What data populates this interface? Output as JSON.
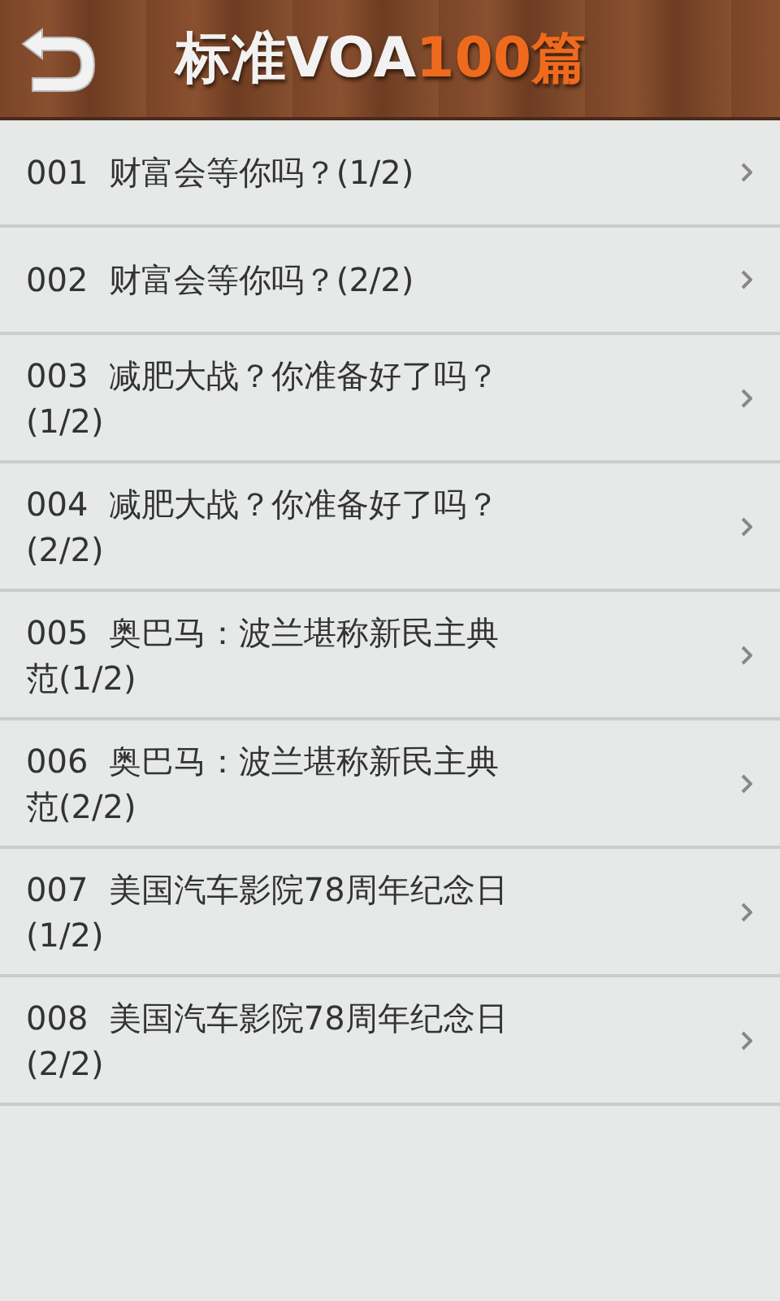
{
  "header": {
    "title": "标准VOA",
    "title_accent": "100篇"
  },
  "items": [
    {
      "number": "001",
      "title": "财富会等你吗？(1/2)"
    },
    {
      "number": "002",
      "title": "财富会等你吗？(2/2)"
    },
    {
      "number": "003",
      "title": "减肥大战？你准备好了吗？(1/2)"
    },
    {
      "number": "004",
      "title": "减肥大战？你准备好了吗？(2/2)"
    },
    {
      "number": "005",
      "title": "奥巴马：波兰堪称新民主典范(1/2)"
    },
    {
      "number": "006",
      "title": "奥巴马：波兰堪称新民主典范(2/2)"
    },
    {
      "number": "007",
      "title": "美国汽车影院78周年纪念日(1/2)"
    },
    {
      "number": "008",
      "title": "美国汽车影院78周年纪念日(2/2)"
    }
  ]
}
